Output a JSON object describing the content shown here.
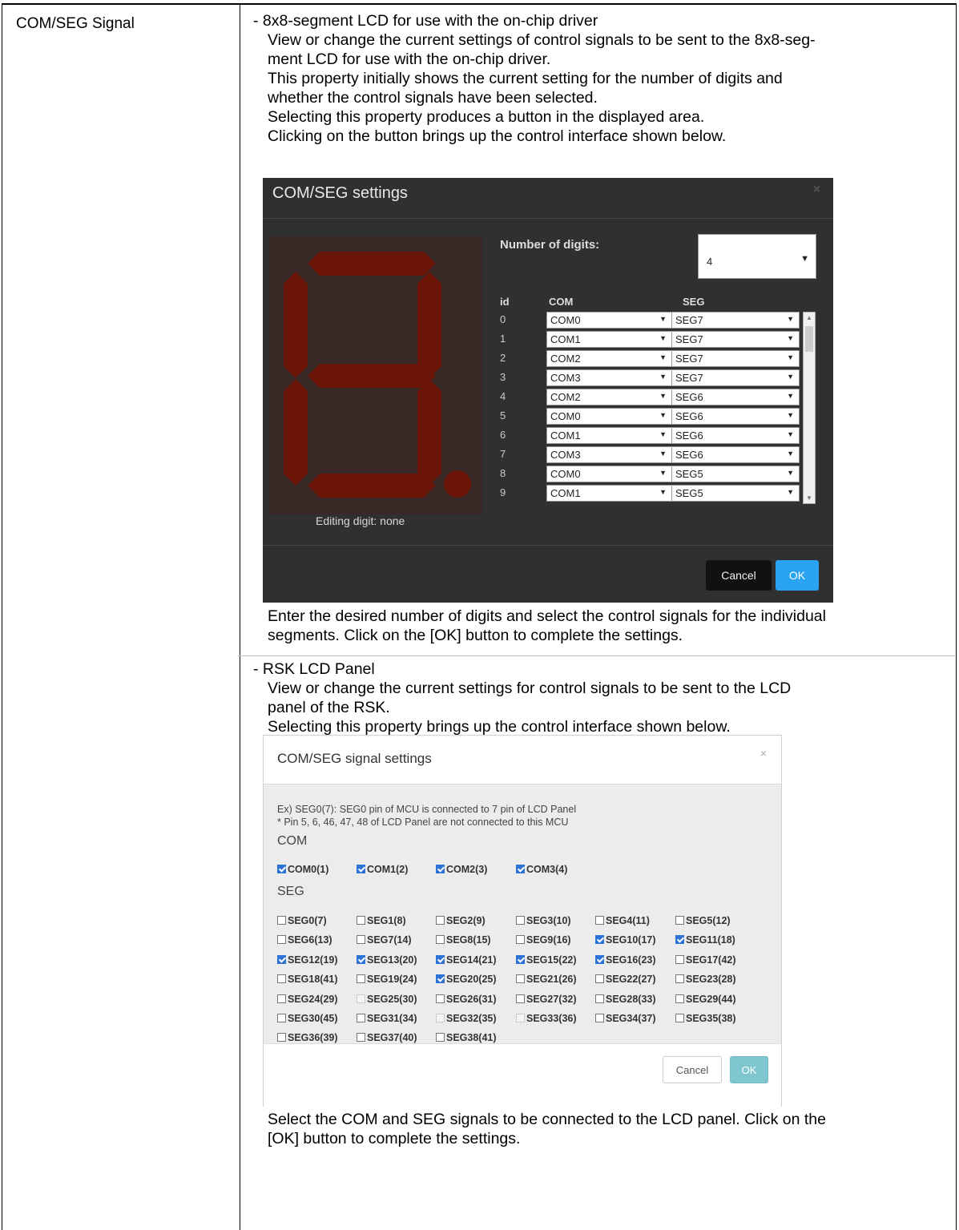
{
  "term": "COM/SEG Signal",
  "section1": {
    "heading": "- 8x8-segment LCD for use with the on-chip driver",
    "lines": [
      "View or change the current settings of control signals to be sent to the 8x8-seg-",
      "ment LCD for use with the on-chip driver.",
      "This property initially shows the current setting for the number of digits and",
      "whether the control signals have been selected.",
      "Selecting this property produces a button in the displayed area.",
      "Clicking on the button brings up the control interface shown below."
    ],
    "after": [
      "Enter the desired number of digits and select the control signals for the individual",
      "segments. Click on the [OK] button to complete the settings."
    ]
  },
  "dark_dialog": {
    "title": "COM/SEG settings",
    "close": "×",
    "editing_label": "Editing digit: none",
    "digits_label": "Number of digits:",
    "digits_value": "4",
    "headers": {
      "id": "id",
      "com": "COM",
      "seg": "SEG"
    },
    "rows": [
      {
        "id": "0",
        "com": "COM0",
        "seg": "SEG7"
      },
      {
        "id": "1",
        "com": "COM1",
        "seg": "SEG7"
      },
      {
        "id": "2",
        "com": "COM2",
        "seg": "SEG7"
      },
      {
        "id": "3",
        "com": "COM3",
        "seg": "SEG7"
      },
      {
        "id": "4",
        "com": "COM2",
        "seg": "SEG6"
      },
      {
        "id": "5",
        "com": "COM0",
        "seg": "SEG6"
      },
      {
        "id": "6",
        "com": "COM1",
        "seg": "SEG6"
      },
      {
        "id": "7",
        "com": "COM3",
        "seg": "SEG6"
      },
      {
        "id": "8",
        "com": "COM0",
        "seg": "SEG5"
      },
      {
        "id": "9",
        "com": "COM1",
        "seg": "SEG5"
      }
    ],
    "cancel": "Cancel",
    "ok": "OK",
    "segment_color": "#6b1408"
  },
  "section2": {
    "heading": "- RSK LCD Panel",
    "lines": [
      "View or change the current settings for control signals to be sent to the LCD",
      "panel of the RSK.",
      "Selecting this property brings up the control interface shown below."
    ],
    "after": [
      "Select the COM and SEG signals to be connected to the LCD panel. Click on the",
      "[OK] button to complete the settings."
    ]
  },
  "light_dialog": {
    "title": "COM/SEG signal settings",
    "close": "×",
    "ex_line1": "Ex) SEG0(7): SEG0 pin of MCU is connected to 7 pin of LCD Panel",
    "ex_line2": "* Pin 5, 6, 46, 47, 48 of LCD Panel are not connected to this MCU",
    "com_label": "COM",
    "seg_label": "SEG",
    "com_items": [
      {
        "label": "COM0(1)",
        "state": "on"
      },
      {
        "label": "COM1(2)",
        "state": "on"
      },
      {
        "label": "COM2(3)",
        "state": "on"
      },
      {
        "label": "COM3(4)",
        "state": "on"
      }
    ],
    "seg_items": [
      {
        "label": "SEG0(7)",
        "state": "off"
      },
      {
        "label": "SEG1(8)",
        "state": "off"
      },
      {
        "label": "SEG2(9)",
        "state": "off"
      },
      {
        "label": "SEG3(10)",
        "state": "off"
      },
      {
        "label": "SEG4(11)",
        "state": "off"
      },
      {
        "label": "SEG5(12)",
        "state": "off"
      },
      {
        "label": "SEG6(13)",
        "state": "off"
      },
      {
        "label": "SEG7(14)",
        "state": "off"
      },
      {
        "label": "SEG8(15)",
        "state": "off"
      },
      {
        "label": "SEG9(16)",
        "state": "off"
      },
      {
        "label": "SEG10(17)",
        "state": "on"
      },
      {
        "label": "SEG11(18)",
        "state": "on"
      },
      {
        "label": "SEG12(19)",
        "state": "on"
      },
      {
        "label": "SEG13(20)",
        "state": "on"
      },
      {
        "label": "SEG14(21)",
        "state": "on"
      },
      {
        "label": "SEG15(22)",
        "state": "on"
      },
      {
        "label": "SEG16(23)",
        "state": "on"
      },
      {
        "label": "SEG17(42)",
        "state": "off"
      },
      {
        "label": "SEG18(41)",
        "state": "off"
      },
      {
        "label": "SEG19(24)",
        "state": "off"
      },
      {
        "label": "SEG20(25)",
        "state": "on"
      },
      {
        "label": "SEG21(26)",
        "state": "off"
      },
      {
        "label": "SEG22(27)",
        "state": "off"
      },
      {
        "label": "SEG23(28)",
        "state": "off"
      },
      {
        "label": "SEG24(29)",
        "state": "off"
      },
      {
        "label": "SEG25(30)",
        "state": "disabled"
      },
      {
        "label": "SEG26(31)",
        "state": "off"
      },
      {
        "label": "SEG27(32)",
        "state": "off"
      },
      {
        "label": "SEG28(33)",
        "state": "off"
      },
      {
        "label": "SEG29(44)",
        "state": "off"
      },
      {
        "label": "SEG30(45)",
        "state": "off"
      },
      {
        "label": "SEG31(34)",
        "state": "off"
      },
      {
        "label": "SEG32(35)",
        "state": "disabled"
      },
      {
        "label": "SEG33(36)",
        "state": "disabled"
      },
      {
        "label": "SEG34(37)",
        "state": "off"
      },
      {
        "label": "SEG35(38)",
        "state": "off"
      },
      {
        "label": "SEG36(39)",
        "state": "off"
      },
      {
        "label": "SEG37(40)",
        "state": "off"
      },
      {
        "label": "SEG38(41)",
        "state": "off"
      }
    ],
    "cancel": "Cancel",
    "ok": "OK"
  }
}
